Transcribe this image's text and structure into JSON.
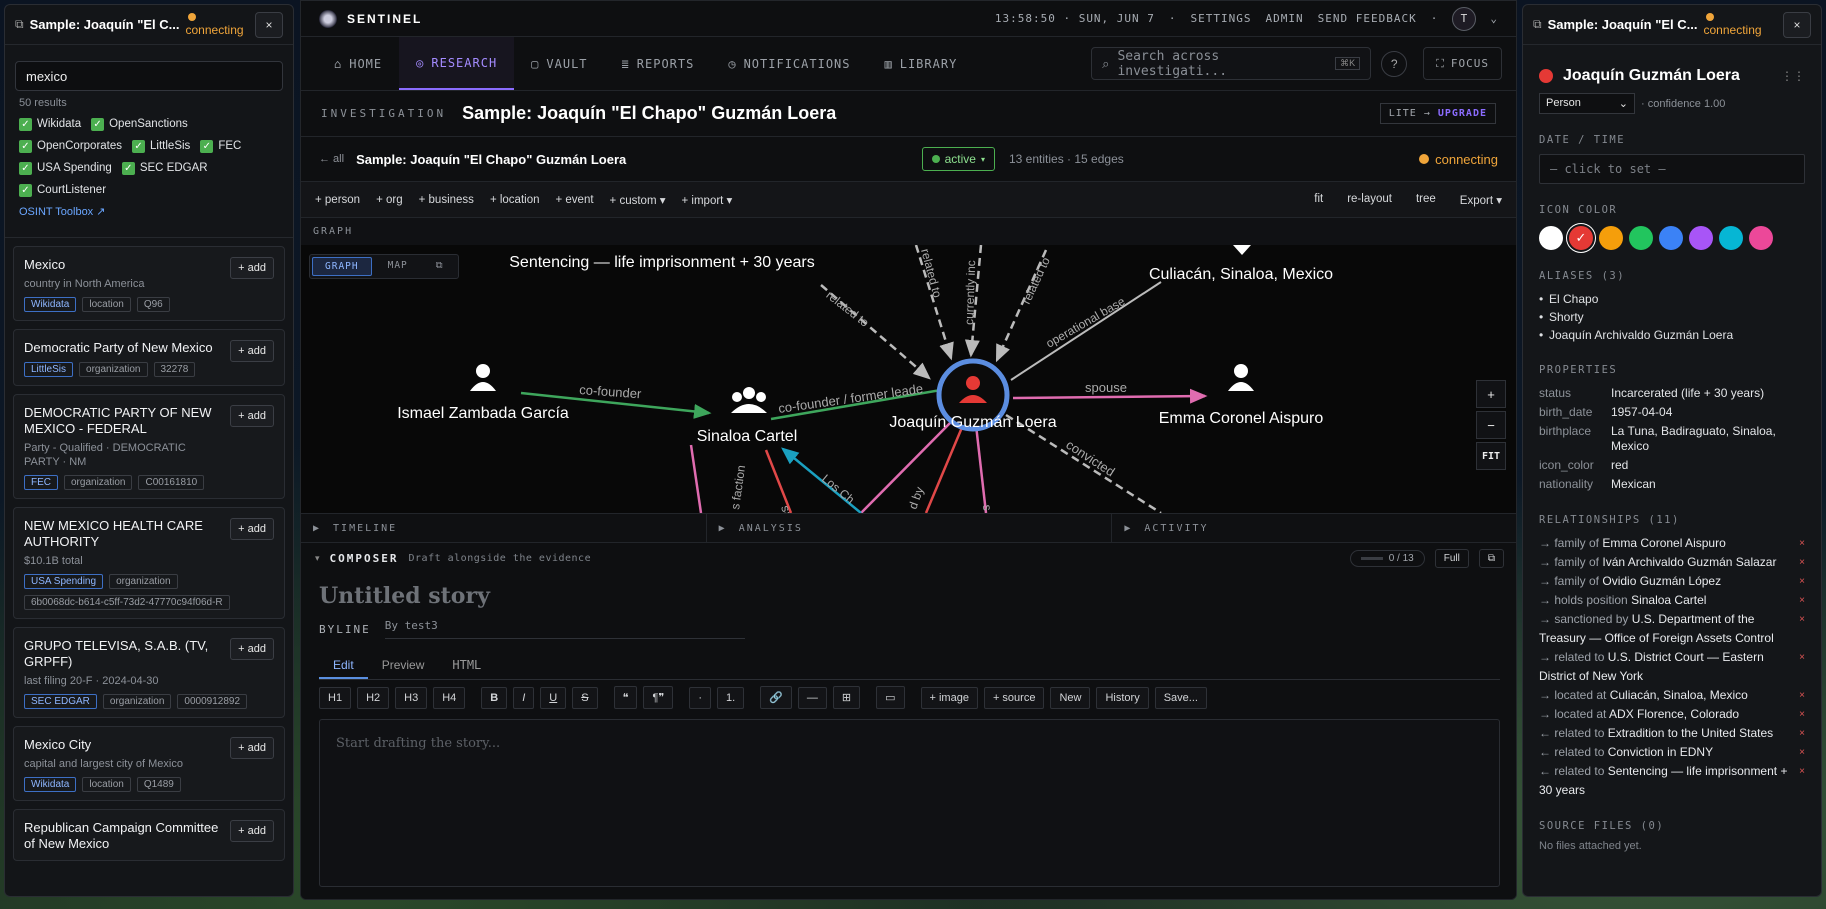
{
  "left_panel": {
    "title": "Sample: Joaquín \"El C...",
    "status": "connecting",
    "close": "×",
    "search_value": "mexico",
    "results": "50 results",
    "sources": [
      "Wikidata",
      "OpenSanctions",
      "OpenCorporates",
      "LittleSis",
      "FEC",
      "USA Spending",
      "SEC EDGAR",
      "CourtListener"
    ],
    "osint_link": "OSINT Toolbox ↗",
    "add_label": "+ add",
    "cards": [
      {
        "name": "Mexico",
        "desc": "country in North America",
        "tags": [
          "Wikidata",
          "location",
          "Q96"
        ]
      },
      {
        "name": "Democratic Party of New Mexico",
        "desc": "",
        "tags": [
          "LittleSis",
          "organization",
          "32278"
        ]
      },
      {
        "name": "DEMOCRATIC PARTY OF NEW MEXICO - FEDERAL",
        "desc": "Party - Qualified · DEMOCRATIC PARTY · NM",
        "tags": [
          "FEC",
          "organization",
          "C00161810"
        ]
      },
      {
        "name": "NEW MEXICO HEALTH CARE AUTHORITY",
        "desc": "$10.1B total",
        "tags": [
          "USA Spending",
          "organization",
          "6b0068dc-b614-c5ff-73d2-47770c94f06d-R"
        ]
      },
      {
        "name": "GRUPO TELEVISA, S.A.B. (TV, GRPFF)",
        "desc": "last filing 20-F · 2024-04-30",
        "tags": [
          "SEC EDGAR",
          "organization",
          "0000912892"
        ]
      },
      {
        "name": "Mexico City",
        "desc": "capital and largest city of Mexico",
        "tags": [
          "Wikidata",
          "location",
          "Q1489"
        ]
      },
      {
        "name": "Republican Campaign Committee of New Mexico",
        "desc": "",
        "tags": []
      }
    ]
  },
  "topbar": {
    "app": "SENTINEL",
    "clock": "13:58:50 · SUN, JUN 7",
    "sep": "·",
    "settings": "SETTINGS",
    "admin": "ADMIN",
    "feedback": "SEND FEEDBACK",
    "avatar": "T"
  },
  "nav": {
    "tabs": [
      {
        "label": "HOME",
        "icon": "⌂"
      },
      {
        "label": "RESEARCH",
        "icon": "◎"
      },
      {
        "label": "VAULT",
        "icon": "▢"
      },
      {
        "label": "REPORTS",
        "icon": "≣"
      },
      {
        "label": "NOTIFICATIONS",
        "icon": "◷"
      },
      {
        "label": "LIBRARY",
        "icon": "▥"
      }
    ],
    "search_placeholder": "Search across investigati...",
    "search_kbd": "⌘K",
    "help": "?",
    "focus": "FOCUS"
  },
  "investigation": {
    "label": "INVESTIGATION",
    "title": "Sample: Joaquín \"El Chapo\" Guzmán Loera",
    "lite": "LITE →",
    "upgrade": "UPGRADE",
    "back": "← all",
    "subtitle": "Sample: Joaquín \"El Chapo\" Guzmán Loera",
    "status": "active",
    "counts": "13 entities · 15 edges",
    "connection": "connecting"
  },
  "toolbar": {
    "add_items": [
      "+ person",
      "+ org",
      "+ business",
      "+ location",
      "+ event",
      "+ custom ▾",
      "+ import ▾"
    ],
    "right_items": [
      "fit",
      "re-layout",
      "tree",
      "Export ▾"
    ]
  },
  "graph": {
    "label": "GRAPH",
    "tabs": [
      "GRAPH",
      "MAP"
    ],
    "zoom_in": "+",
    "zoom_out": "−",
    "fit": "FIT",
    "nodes": {
      "sentencing": "Sentencing — life imprisonment + 30 years",
      "culiacan": "Culiacán, Sinaloa, Mexico",
      "ismael": "Ismael Zambada García",
      "cartel": "Sinaloa Cartel",
      "joaquin": "Joaquín Guzmán Loera",
      "emma": "Emma Coronel Aispuro"
    },
    "edges": {
      "related1": "related to",
      "related2": "related to",
      "related3": "related to",
      "currently": "currently inc",
      "operational": "operational base",
      "cofounder": "co-founder",
      "cofounder_former": "co-founder / former leade",
      "spouse": "spouse",
      "convicted": "convicted",
      "faction": "s faction",
      "losch": "Los Ch",
      "sa": "sa",
      "dby": "d by",
      "s": "s"
    }
  },
  "panels": [
    "TIMELINE",
    "ANALYSIS",
    "ACTIVITY"
  ],
  "composer": {
    "title": "COMPOSER",
    "subtitle": "Draft alongside the evidence",
    "progress": "0 / 13",
    "full": "Full",
    "story_title": "Untitled story",
    "byline_label": "BYLINE",
    "byline_value": "By test3",
    "tabs": [
      "Edit",
      "Preview",
      "HTML"
    ],
    "format_buttons": [
      "H1",
      "H2",
      "H3",
      "H4",
      "B",
      "I",
      "U",
      "S",
      "❝",
      "¶❞",
      "·",
      "1.",
      "🔗",
      "—",
      "⊞",
      "▭"
    ],
    "insert_buttons": [
      "+ image",
      "+ source",
      "New",
      "History",
      "Save..."
    ],
    "placeholder": "Start drafting the story..."
  },
  "right_panel": {
    "title": "Sample: Joaquín \"El C...",
    "status": "connecting",
    "close": "×",
    "entity": "Joaquín Guzmán Loera",
    "type": "Person",
    "confidence": "· confidence 1.00",
    "date_label": "DATE / TIME",
    "date_placeholder": "— click to set —",
    "icon_color_label": "ICON COLOR",
    "colors": [
      "#ffffff",
      "#e53935",
      "#f59e0b",
      "#22c55e",
      "#3b82f6",
      "#a855f7",
      "#06b6d4",
      "#ec4899"
    ],
    "aliases_label": "ALIASES (3)",
    "aliases": [
      "El Chapo",
      "Shorty",
      "Joaquín Archivaldo Guzmán Loera"
    ],
    "properties_label": "PROPERTIES",
    "properties": [
      {
        "k": "status",
        "v": "Incarcerated (life + 30 years)"
      },
      {
        "k": "birth_date",
        "v": "1957-04-04"
      },
      {
        "k": "birthplace",
        "v": "La Tuna, Badiraguato, Sinaloa, Mexico"
      },
      {
        "k": "icon_color",
        "v": "red"
      },
      {
        "k": "nationality",
        "v": "Mexican"
      }
    ],
    "relationships_label": "RELATIONSHIPS (11)",
    "relationships": [
      {
        "p": "→ family of ",
        "t": "Emma Coronel Aispuro"
      },
      {
        "p": "→ family of ",
        "t": "Iván Archivaldo Guzmán Salazar"
      },
      {
        "p": "→ family of ",
        "t": "Ovidio Guzmán López"
      },
      {
        "p": "→ holds position ",
        "t": "Sinaloa Cartel"
      },
      {
        "p": "→ sanctioned by ",
        "t": "U.S. Department of the Treasury — Office of Foreign Assets Control"
      },
      {
        "p": "→ related to ",
        "t": "U.S. District Court — Eastern District of New York"
      },
      {
        "p": "→ located at ",
        "t": "Culiacán, Sinaloa, Mexico"
      },
      {
        "p": "→ located at ",
        "t": "ADX Florence, Colorado"
      },
      {
        "p": "← related to ",
        "t": "Extradition to the United States"
      },
      {
        "p": "← related to ",
        "t": "Conviction in EDNY"
      },
      {
        "p": "← related to ",
        "t": "Sentencing — life imprisonment + 30 years"
      }
    ],
    "source_files_label": "SOURCE FILES (0)",
    "no_files": "No files attached yet."
  }
}
